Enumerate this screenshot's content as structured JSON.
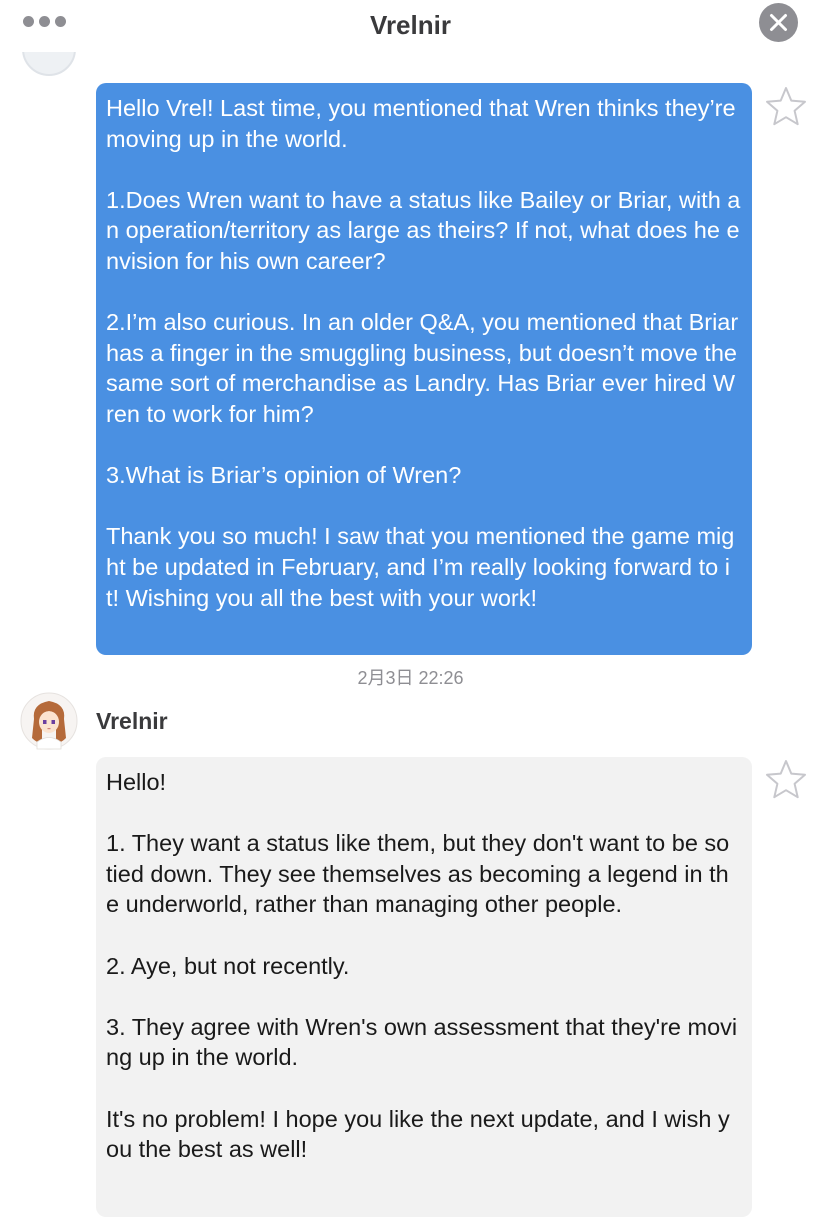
{
  "header": {
    "title": "Vrelnir",
    "menu_icon": "ellipsis-icon",
    "close_icon": "close-icon"
  },
  "colors": {
    "sent_bubble": "#4a90e2",
    "received_bubble": "#f2f2f2",
    "icon_gray": "#8e8e93"
  },
  "messages": [
    {
      "direction": "outgoing",
      "text": "Hello Vrel! Last time, you mentioned that Wren thinks they’re moving up in the world.\n\n1.Does Wren want to have a status like Bailey or Briar, with an operation/territory as large as theirs? If not, what does he envision for his own career?\n\n2.I’m also curious. In an older Q&A, you mentioned that Briar has a finger in the smuggling business, but doesn’t move the same sort of merchandise as Landry. Has Briar ever hired Wren to work for him?\n\n3.What is Briar’s opinion of Wren?\n\nThank you so much! I saw that you mentioned the game might be updated in February, and I’m really looking forward to it! Wishing you all the best with your work!"
    },
    {
      "direction": "incoming",
      "timestamp": "2月3日 22:26",
      "sender": "Vrelnir",
      "text": "Hello!\n\n1. They want a status like them, but they don't want to be so tied down. They see themselves as becoming a legend in the underworld, rather than managing other people.\n\n2. Aye, but not recently.\n\n3. They agree with Wren's own assessment that they're moving up in the world.\n\nIt's no problem! I hope you like the next update, and I wish you the best as well!"
    }
  ]
}
